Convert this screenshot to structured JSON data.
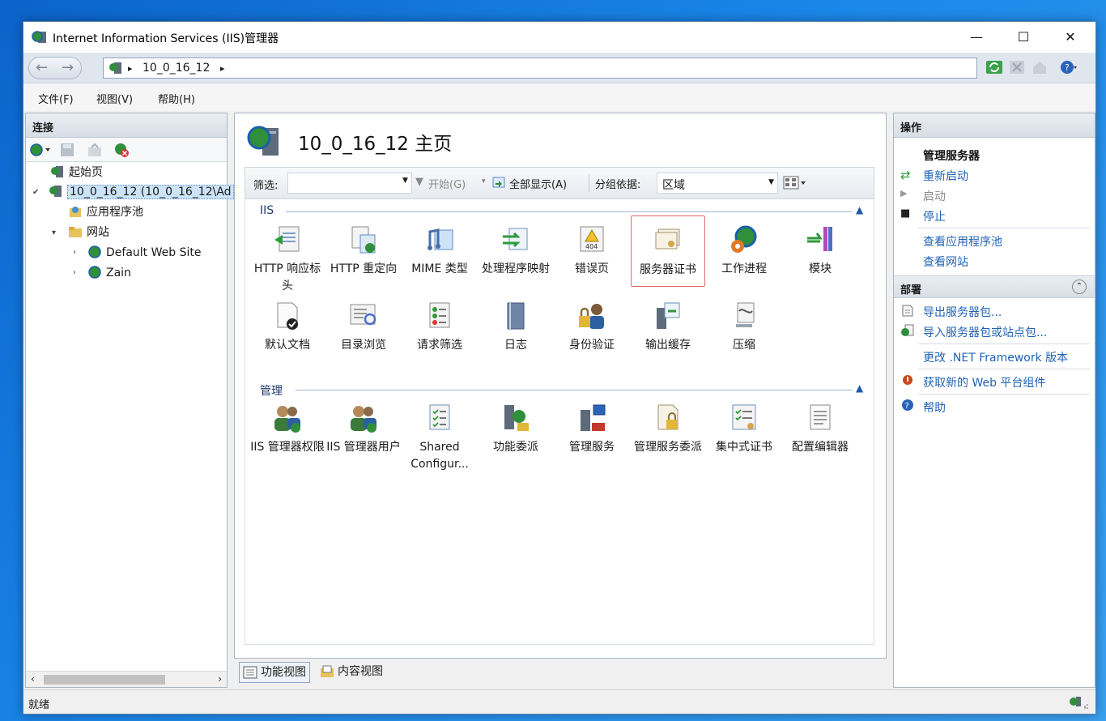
{
  "window": {
    "title": "Internet Information Services (IIS)管理器",
    "minimize": "—",
    "maximize": "☐",
    "close": "✕"
  },
  "address": {
    "crumb_sep": "▸",
    "node": "10_0_16_12"
  },
  "menu": [
    "文件(F)",
    "视图(V)",
    "帮助(H)"
  ],
  "connections": {
    "title": "连接",
    "tree": {
      "start": "起始页",
      "server": "10_0_16_12 (10_0_16_12\\Ad",
      "app_pools": "应用程序池",
      "sites": "网站",
      "site1": "Default Web Site",
      "site2": "Zain"
    }
  },
  "center": {
    "title": "10_0_16_12 主页",
    "filter_label": "筛选:",
    "start_btn": "开始(G)",
    "show_all_btn": "全部显示(A)",
    "group_label": "分组依据:",
    "group_value": "区域",
    "groups": [
      {
        "name": "IIS",
        "items": [
          "HTTP 响应标头",
          "HTTP 重定向",
          "MIME 类型",
          "处理程序映射",
          "错误页",
          "服务器证书",
          "工作进程",
          "模块",
          "默认文档",
          "目录浏览",
          "请求筛选",
          "日志",
          "身份验证",
          "输出缓存",
          "压缩"
        ]
      },
      {
        "name": "管理",
        "items": [
          "IIS 管理器权限",
          "IIS 管理器用户",
          "Shared Configur...",
          "功能委派",
          "管理服务",
          "管理服务委派",
          "集中式证书",
          "配置编辑器"
        ]
      }
    ]
  },
  "view_tabs": {
    "features": "功能视图",
    "content": "内容视图"
  },
  "actions": {
    "title": "操作",
    "manage_server": "管理服务器",
    "restart": "重新启动",
    "start": "启动",
    "stop": "停止",
    "view_app_pools": "查看应用程序池",
    "view_sites": "查看网站",
    "deploy_title": "部署",
    "export_pkg": "导出服务器包...",
    "import_pkg": "导入服务器包或站点包...",
    "change_net": "更改 .NET Framework 版本",
    "get_web": "获取新的 Web 平台组件",
    "help": "帮助"
  },
  "status": {
    "text": "就绪"
  },
  "colors": {
    "accent": "#1f63b5",
    "selected_border": "#e06a6a"
  }
}
